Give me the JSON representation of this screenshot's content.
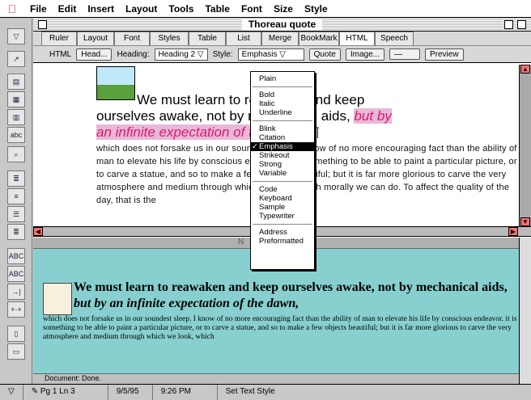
{
  "menubar": {
    "items": [
      "File",
      "Edit",
      "Insert",
      "Layout",
      "Tools",
      "Table",
      "Font",
      "Size",
      "Style"
    ]
  },
  "window": {
    "title": "Thoreau quote"
  },
  "tabs": [
    "Ruler",
    "Layout",
    "Font",
    "Styles",
    "Table",
    "List",
    "Merge",
    "BookMark",
    "HTML",
    "Speech"
  ],
  "active_tab": "HTML",
  "controls": {
    "html_label": "HTML",
    "head_button": "Head...",
    "heading_label": "Heading:",
    "heading_value": "Heading 2",
    "style_label": "Style:",
    "style_value": "Emphasis",
    "quote_button": "Quote",
    "image_button": "Image...",
    "preview_button": "Preview"
  },
  "editor": {
    "heading_line1": "We must learn to reawaken and keep",
    "heading_line2": "ourselves awake, not by mechanical aids,",
    "heading_emph1": "but by",
    "heading_emph2": "an infinite expectation of the dawn,",
    "paragraph_mark": "¶",
    "body": "which does not forsake us in our soundest sleep. I know of no more encouraging fact than the ability of man to elevate his life by conscious endeavor. It is something to be able to paint a particular picture, or to carve a statue, and so to make a few objects beautiful; but it is far more glorious to carve the very atmosphere and medium through which we look, which morally we can do. To affect the quality of the day, that is the"
  },
  "style_menu": {
    "groups": [
      [
        "Plain"
      ],
      [
        "Bold",
        "Italic",
        "Underline"
      ],
      [
        "Blink",
        "Citation",
        "Emphasis",
        "Strikeout",
        "Strong",
        "Variable"
      ],
      [
        "Code",
        "Keyboard",
        "Sample",
        "Typewriter"
      ],
      [
        "Address",
        "Preformatted"
      ]
    ],
    "checked": "Emphasis"
  },
  "preview": {
    "title_partial_left": "N",
    "title_partial_right": "au",
    "heading": "We must learn to reawaken and keep ourselves awake, not by mechanical aids,",
    "heading_emph": "but by an infinite expectation of the dawn,",
    "body": "which does not forsake us in our soundest sleep. I know of no more encouraging fact than the ability of man to elevate his life by conscious endeavor. it is something to be able to paint a particular picture, or to carve a statue, and so to make a few objects beautiful; but it is far more glorious to carve the very atmosphere and medium through which we look, which",
    "status": "Document: Done."
  },
  "status": {
    "page": "Pg 1  Ln 3",
    "date": "9/5/95",
    "time": "9:26 PM",
    "message": "Set Text Style"
  },
  "colors": {
    "emphasis": "#e0186a",
    "emphasis_bg": "#e8b8d8",
    "preview_bg": "#88d0d0"
  }
}
